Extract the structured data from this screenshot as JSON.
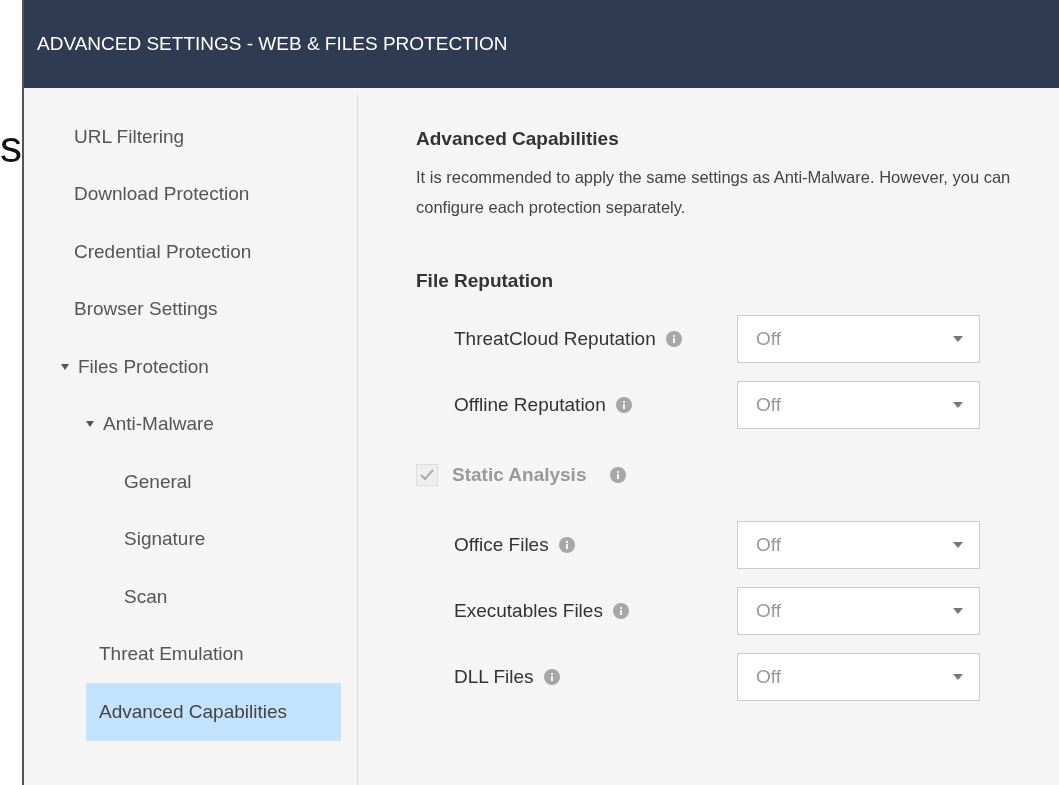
{
  "background_text": "s",
  "window": {
    "title": "ADVANCED SETTINGS - WEB & FILES PROTECTION"
  },
  "sidebar": {
    "items": [
      {
        "label": "URL Filtering",
        "selected": false
      },
      {
        "label": "Download Protection",
        "selected": false
      },
      {
        "label": "Credential Protection",
        "selected": false
      },
      {
        "label": "Browser Settings",
        "selected": false
      },
      {
        "label": "Files Protection",
        "selected": false,
        "expanded": true,
        "children": [
          {
            "label": "Anti-Malware",
            "selected": false,
            "expanded": true,
            "children": [
              {
                "label": "General",
                "selected": false
              },
              {
                "label": "Signature",
                "selected": false
              },
              {
                "label": "Scan",
                "selected": false
              }
            ]
          },
          {
            "label": "Threat Emulation",
            "selected": false
          },
          {
            "label": "Advanced Capabilities",
            "selected": true
          }
        ]
      }
    ]
  },
  "content": {
    "title": "Advanced Capabilities",
    "description": "It is recommended to apply the same settings as Anti-Malware. However, you can configure each protection separately.",
    "section": "File Reputation",
    "rows": [
      {
        "kind": "select",
        "label": "ThreatCloud Reputation",
        "value": "Off"
      },
      {
        "kind": "select",
        "label": "Offline Reputation",
        "value": "Off"
      },
      {
        "kind": "checkbox",
        "label": "Static Analysis",
        "checked": true,
        "disabled": true
      },
      {
        "kind": "select",
        "label": "Office Files",
        "value": "Off"
      },
      {
        "kind": "select",
        "label": "Executables Files",
        "value": "Off"
      },
      {
        "kind": "select",
        "label": "DLL Files",
        "value": "Off"
      }
    ]
  }
}
